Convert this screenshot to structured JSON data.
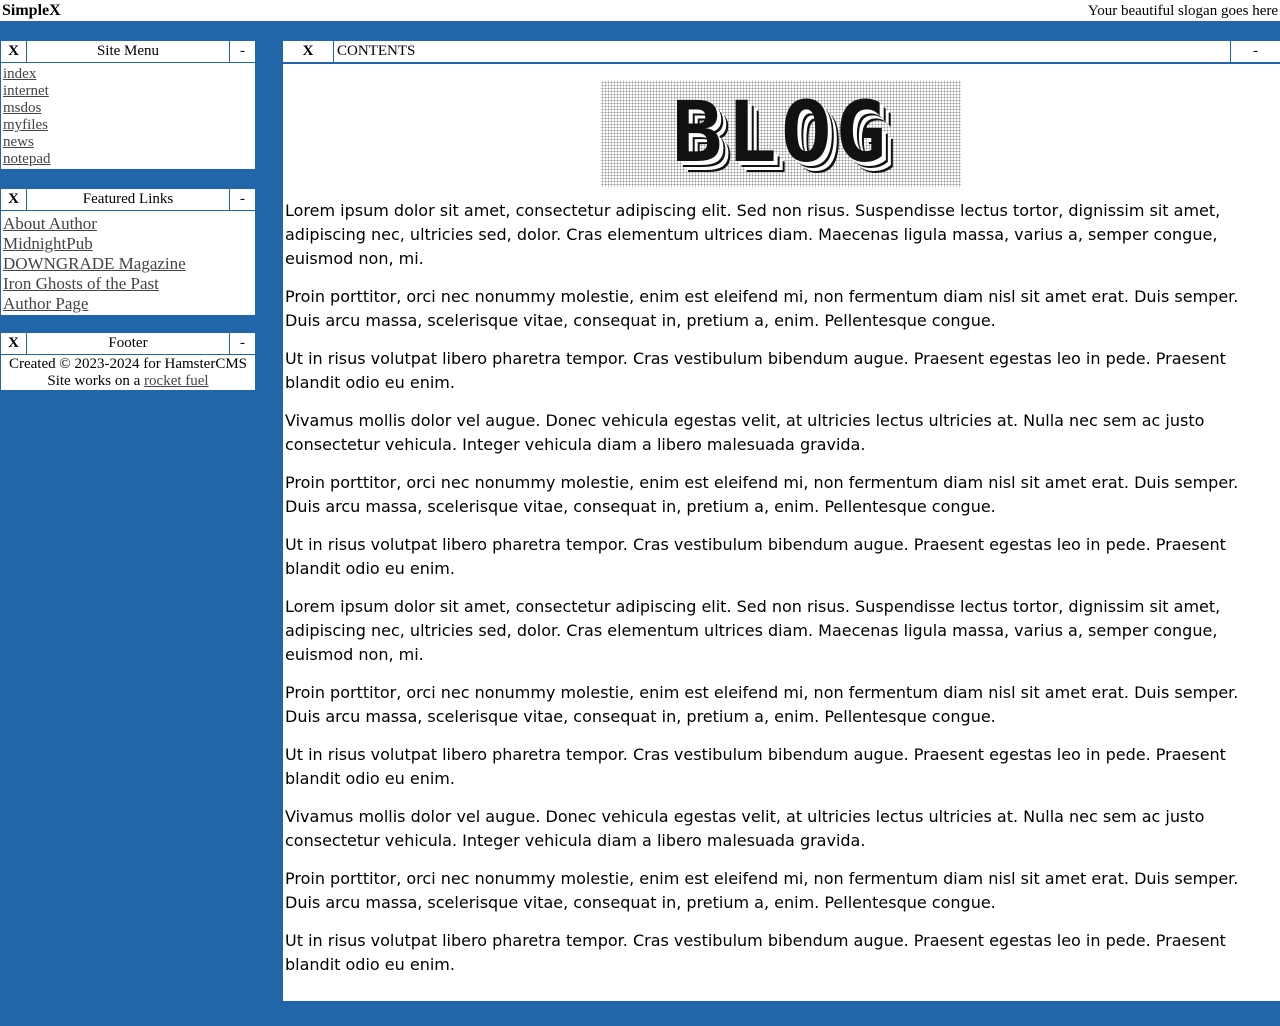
{
  "header": {
    "brand_simple": "Simple",
    "brand_x": "X",
    "slogan": "Your beautiful slogan goes here"
  },
  "site_menu": {
    "close": "X",
    "title": "Site Menu",
    "minimize": "-",
    "items": [
      "index",
      "internet",
      "msdos",
      "myfiles",
      "news",
      "notepad"
    ]
  },
  "featured_links": {
    "close": "X",
    "title": "Featured Links",
    "minimize": "-",
    "items": [
      "About Author",
      "MidnightPub",
      "DOWNGRADE Magazine",
      "Iron Ghosts of the Past",
      "Author Page"
    ]
  },
  "footer": {
    "close": "X",
    "title": "Footer",
    "minimize": "-",
    "line1": "Created © 2023-2024 for HamsterCMS",
    "line2_prefix": "Site works on a ",
    "line2_link": "rocket fuel"
  },
  "contents": {
    "close": "X",
    "title": "CONTENTS",
    "minimize": "-",
    "banner": "BLOG",
    "paragraphs": [
      "Lorem ipsum dolor sit amet, consectetur adipiscing elit. Sed non risus. Suspendisse lectus tortor, dignissim sit amet, adipiscing nec, ultricies sed, dolor. Cras elementum ultrices diam. Maecenas ligula massa, varius a, semper congue, euismod non, mi.",
      "Proin porttitor, orci nec nonummy molestie, enim est eleifend mi, non fermentum diam nisl sit amet erat. Duis semper. Duis arcu massa, scelerisque vitae, consequat in, pretium a, enim. Pellentesque congue.",
      "Ut in risus volutpat libero pharetra tempor. Cras vestibulum bibendum augue. Praesent egestas leo in pede. Praesent blandit odio eu enim.",
      "Vivamus mollis dolor vel augue. Donec vehicula egestas velit, at ultricies lectus ultricies at. Nulla nec sem ac justo consectetur vehicula. Integer vehicula diam a libero malesuada gravida.",
      "Proin porttitor, orci nec nonummy molestie, enim est eleifend mi, non fermentum diam nisl sit amet erat. Duis semper. Duis arcu massa, scelerisque vitae, consequat in, pretium a, enim. Pellentesque congue.",
      "Ut in risus volutpat libero pharetra tempor. Cras vestibulum bibendum augue. Praesent egestas leo in pede. Praesent blandit odio eu enim.",
      "Lorem ipsum dolor sit amet, consectetur adipiscing elit. Sed non risus. Suspendisse lectus tortor, dignissim sit amet, adipiscing nec, ultricies sed, dolor. Cras elementum ultrices diam. Maecenas ligula massa, varius a, semper congue, euismod non, mi.",
      "Proin porttitor, orci nec nonummy molestie, enim est eleifend mi, non fermentum diam nisl sit amet erat. Duis semper. Duis arcu massa, scelerisque vitae, consequat in, pretium a, enim. Pellentesque congue.",
      "Ut in risus volutpat libero pharetra tempor. Cras vestibulum bibendum augue. Praesent egestas leo in pede. Praesent blandit odio eu enim.",
      "Vivamus mollis dolor vel augue. Donec vehicula egestas velit, at ultricies lectus ultricies at. Nulla nec sem ac justo consectetur vehicula. Integer vehicula diam a libero malesuada gravida.",
      "Proin porttitor, orci nec nonummy molestie, enim est eleifend mi, non fermentum diam nisl sit amet erat. Duis semper. Duis arcu massa, scelerisque vitae, consequat in, pretium a, enim. Pellentesque congue.",
      "Ut in risus volutpat libero pharetra tempor. Cras vestibulum bibendum augue. Praesent egestas leo in pede. Praesent blandit odio eu enim."
    ]
  },
  "colors": {
    "background": "#2166a9",
    "panel": "#ffffff",
    "link": "#444444"
  }
}
